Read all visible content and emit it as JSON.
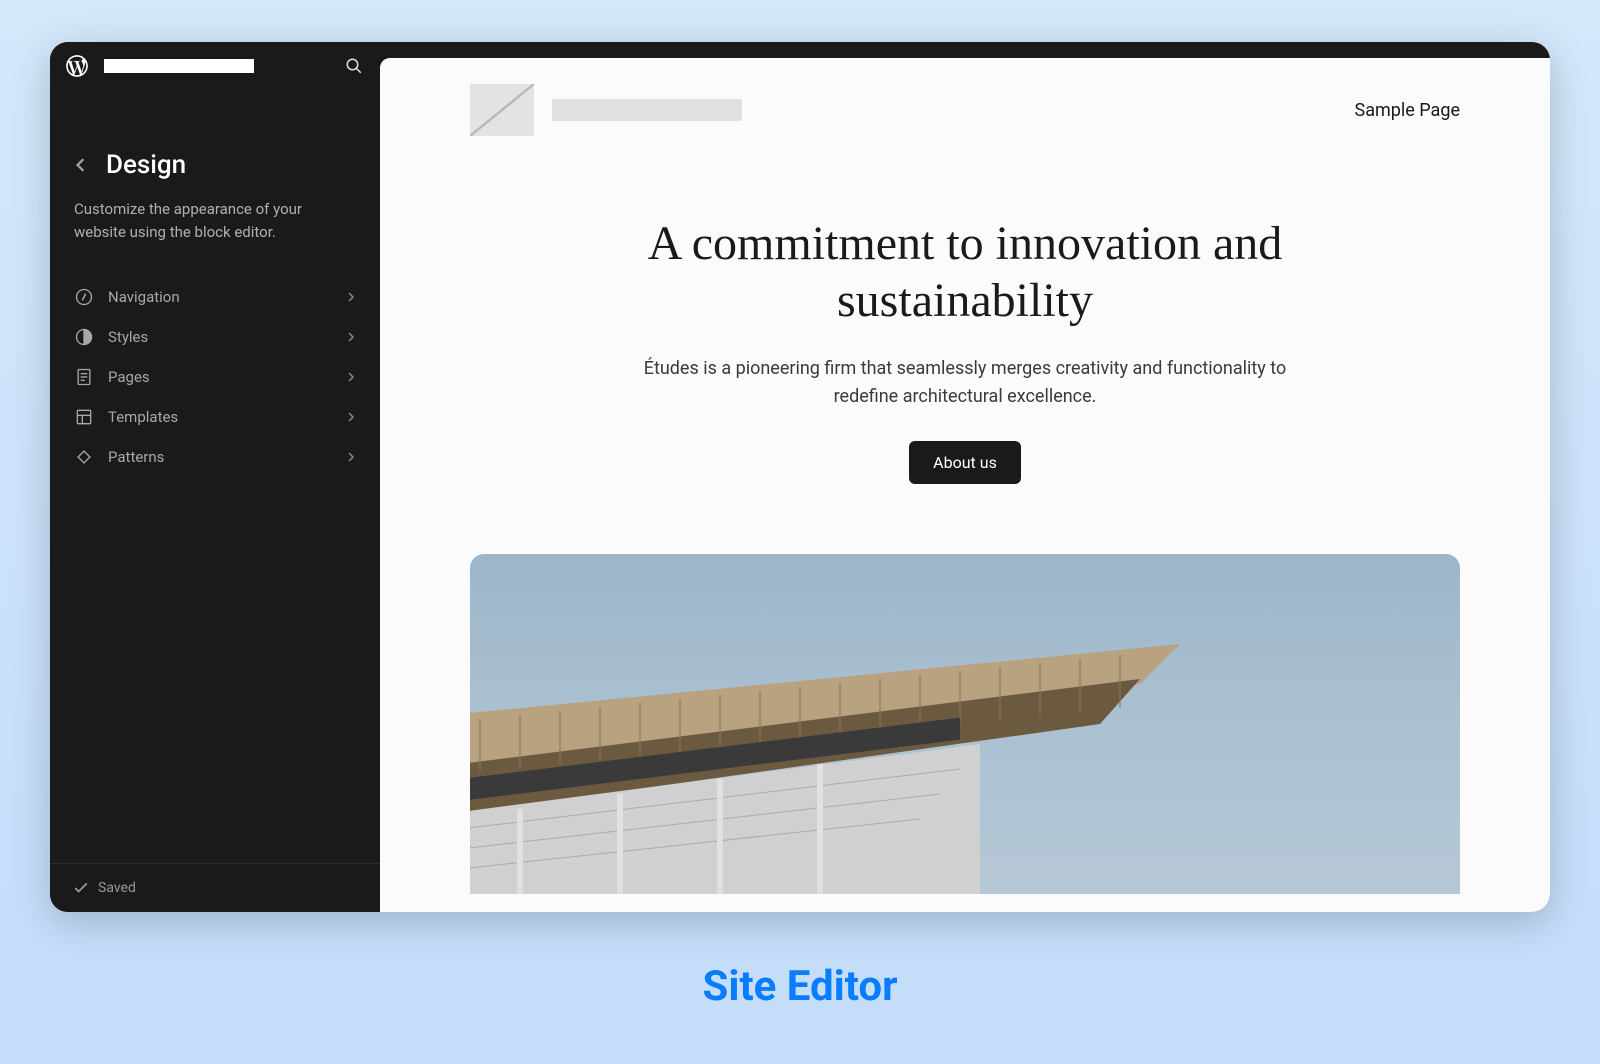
{
  "sidebar": {
    "title": "Design",
    "description": "Customize the appearance of your website using the block editor.",
    "items": [
      {
        "label": "Navigation",
        "icon": "compass"
      },
      {
        "label": "Styles",
        "icon": "contrast"
      },
      {
        "label": "Pages",
        "icon": "page"
      },
      {
        "label": "Templates",
        "icon": "layout"
      },
      {
        "label": "Patterns",
        "icon": "diamond"
      }
    ],
    "footer_status": "Saved"
  },
  "canvas": {
    "nav_link": "Sample Page",
    "hero_title": "A commitment to innovation and sustainability",
    "hero_sub": "Études is a pioneering firm that seamlessly merges creativity and functionality to redefine architectural excellence.",
    "cta_label": "About us"
  },
  "caption": "Site Editor"
}
